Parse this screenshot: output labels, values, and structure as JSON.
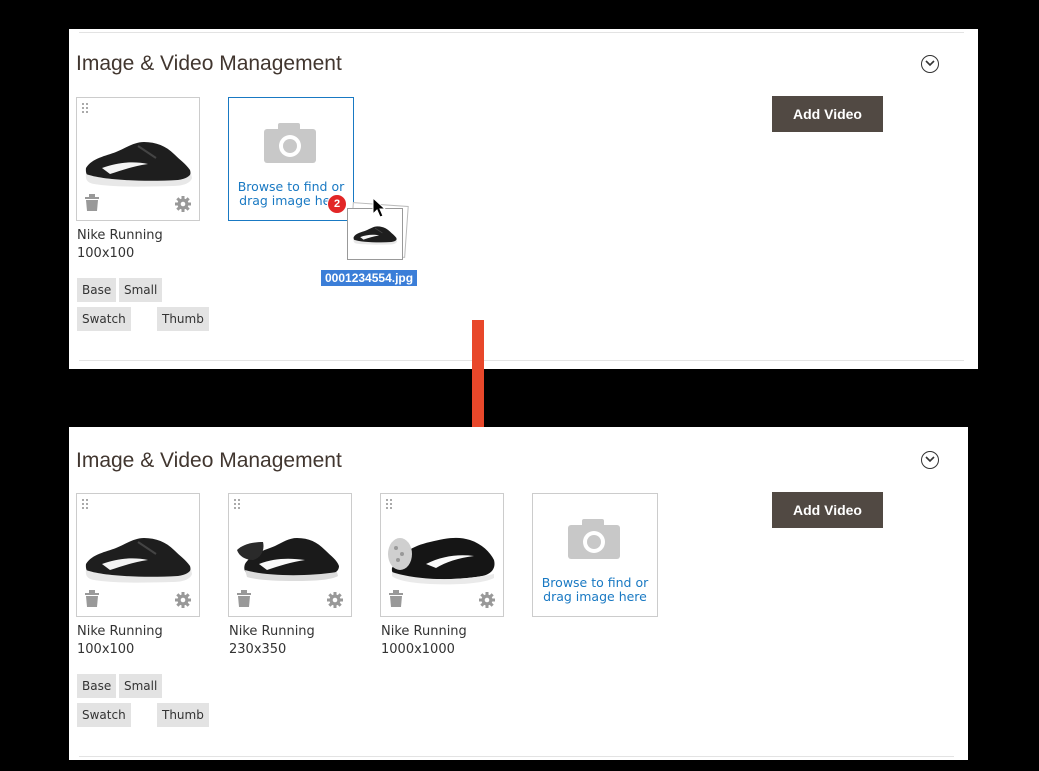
{
  "section_title": "Image & Video Management",
  "add_video_label": "Add Video",
  "upload": {
    "browse_line1": "Browse to find or",
    "browse_line2": "drag image here"
  },
  "before": {
    "images": [
      {
        "name": "Nike Running",
        "size": "100x100"
      }
    ],
    "roles": [
      "Base",
      "Small",
      "Swatch",
      "Thumb"
    ],
    "drag": {
      "count": "2",
      "filename": "0001234554.jpg"
    }
  },
  "after": {
    "images": [
      {
        "name": "Nike Running",
        "size": "100x100"
      },
      {
        "name": "Nike Running",
        "size": "230x350"
      },
      {
        "name": "Nike Running",
        "size": "1000x1000"
      }
    ],
    "roles": [
      "Base",
      "Small",
      "Swatch",
      "Thumb"
    ]
  },
  "icons": {
    "collapse": "chevron-circle-icon",
    "drag": "drag-handle-icon",
    "delete": "trash-icon",
    "settings": "gear-icon",
    "camera": "camera-icon",
    "arrow": "arrow-down-icon"
  },
  "colors": {
    "accent_link": "#1979c3",
    "button_bg": "#514943",
    "badge": "#e22626",
    "arrow": "#e8472a",
    "filename_bg": "#3b7ed8"
  }
}
